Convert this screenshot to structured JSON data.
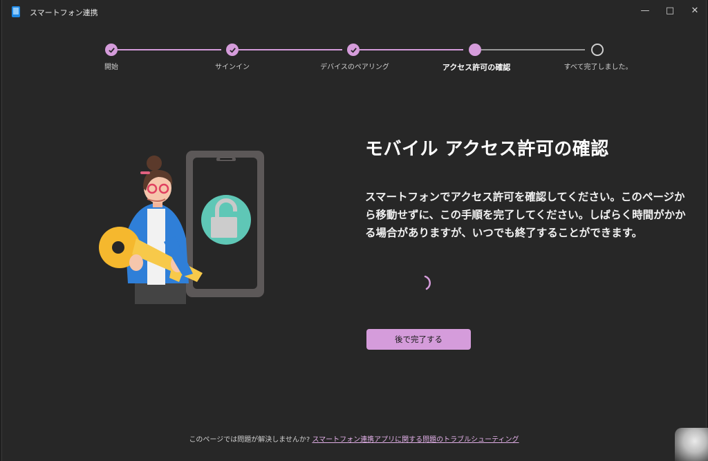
{
  "window": {
    "title": "スマートフォン連携"
  },
  "steps": [
    {
      "label": "開始",
      "state": "done"
    },
    {
      "label": "サインイン",
      "state": "done"
    },
    {
      "label": "デバイスのペアリング",
      "state": "done"
    },
    {
      "label": "アクセス許可の確認",
      "state": "current"
    },
    {
      "label": "すべて完了しました。",
      "state": "pending"
    }
  ],
  "main": {
    "title": "モバイル アクセス許可の確認",
    "description": "スマートフォンでアクセス許可を確認してください。このページから移動せずに、この手順を完了してください。しばらく時間がかかる場合がありますが、いつでも終了することができます。",
    "later_button": "後で完了する"
  },
  "footer": {
    "text": "このページでは問題が解決しませんか?",
    "link": "スマートフォン連携アプリに関する問題のトラブルシューティング"
  },
  "colors": {
    "accent": "#d59cdb",
    "background": "#272727",
    "lock_circle": "#5fc7b6",
    "key": "#f5b82e"
  },
  "icons": [
    "app-icon",
    "minimize-icon",
    "maximize-icon",
    "close-icon",
    "checkmark-icon",
    "lock-icon",
    "key-icon",
    "spinner-icon"
  ]
}
